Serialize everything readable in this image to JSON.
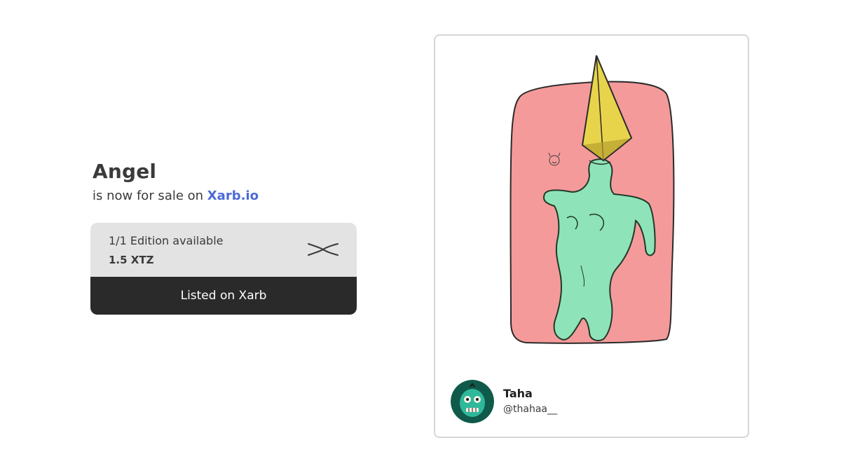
{
  "listing": {
    "title": "Angel",
    "subtitle_prefix": "is now for sale on ",
    "marketplace": "Xarb.io",
    "edition": "1/1 Edition available",
    "price": "1.5 XTZ",
    "cta_label": "Listed on Xarb"
  },
  "artist": {
    "name": "Taha",
    "handle": "@thahaa__"
  },
  "icons": {
    "marketplace_logo": "xarb-x-icon",
    "avatar": "zombie-avatar-icon"
  },
  "colors": {
    "brand": "#4a6ad8",
    "button_bg": "#2a2a2a",
    "card_bg": "#e3e3e3",
    "artwork_bg": "#f59a9a",
    "sculpture": "#8fe3b8",
    "pyramid": "#e8d44a"
  }
}
